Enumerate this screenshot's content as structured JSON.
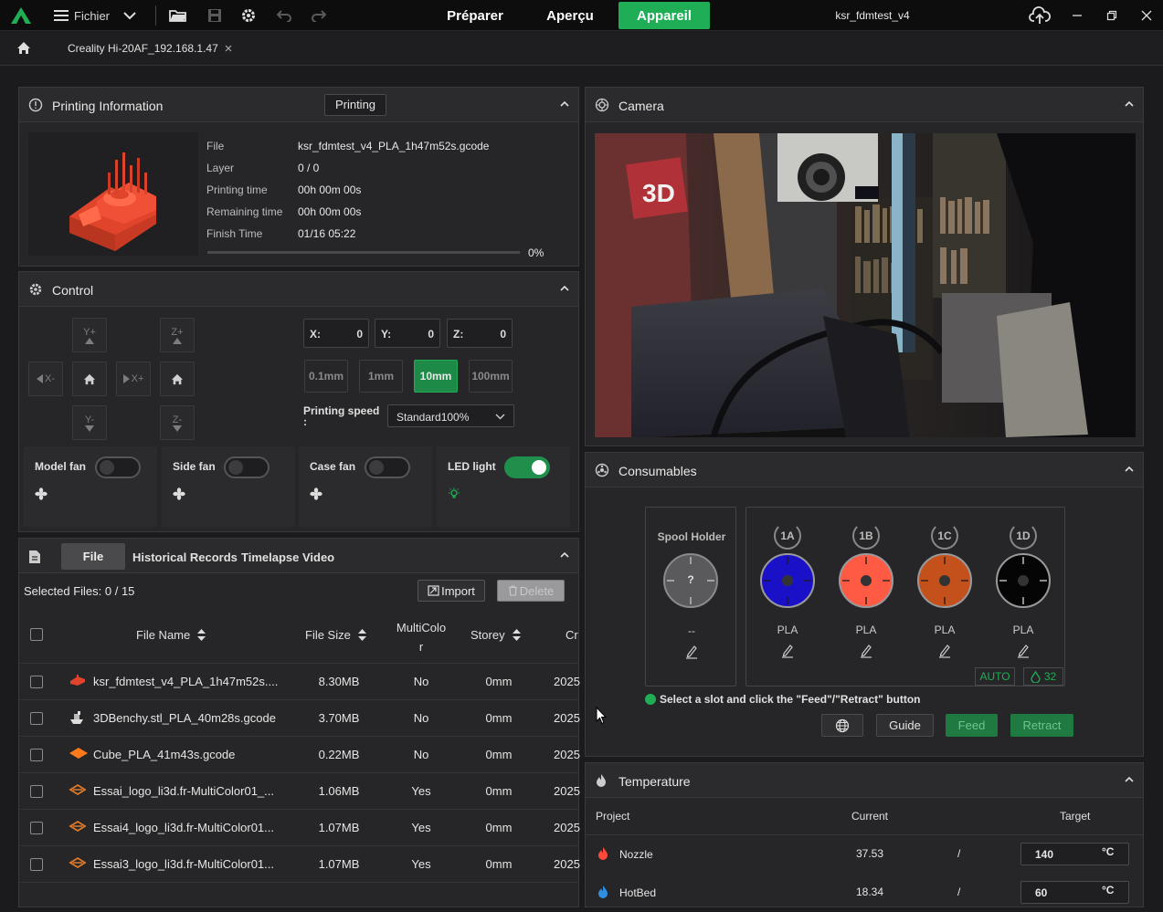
{
  "app": {
    "menu_label": "Fichier",
    "modes": [
      "Préparer",
      "Aperçu",
      "Appareil"
    ],
    "active_mode": "Appareil",
    "project_title": "ksr_fdmtest_v4"
  },
  "tab": {
    "label": "Creality Hi-20AF_192.168.1.47"
  },
  "printing_info": {
    "title": "Printing Information",
    "status": "Printing",
    "fields": [
      {
        "label": "File",
        "value": "ksr_fdmtest_v4_PLA_1h47m52s.gcode"
      },
      {
        "label": "Layer",
        "value": "0 / 0"
      },
      {
        "label": "Printing time",
        "value": "00h 00m 00s"
      },
      {
        "label": "Remaining time",
        "value": "00h 00m 00s"
      },
      {
        "label": "Finish Time",
        "value": "01/16 05:22"
      }
    ],
    "progress_text": "0%",
    "progress": 0
  },
  "control": {
    "title": "Control",
    "jog": {
      "y_plus": "Y+",
      "y_minus": "Y-",
      "x_minus": "X-",
      "x_plus": "X+",
      "z_plus": "Z+",
      "z_minus": "Z-"
    },
    "coords": [
      {
        "label": "X:",
        "value": "0"
      },
      {
        "label": "Y:",
        "value": "0"
      },
      {
        "label": "Z:",
        "value": "0"
      }
    ],
    "steps": [
      "0.1mm",
      "1mm",
      "10mm",
      "100mm"
    ],
    "active_step": "10mm",
    "speed_label": "Printing speed",
    "speed_colon": ":",
    "speed_value": "Standard100%",
    "fans": [
      {
        "label": "Model fan",
        "on": false
      },
      {
        "label": "Side fan",
        "on": false
      },
      {
        "label": "Case fan",
        "on": false
      },
      {
        "label": "LED light",
        "on": true
      }
    ]
  },
  "files": {
    "tabs": [
      "File",
      "Historical Records",
      "Timelapse Video"
    ],
    "active_tab": "File",
    "selected_text": "Selected Files: 0 / 15",
    "import_label": "Import",
    "delete_label": "Delete",
    "columns": {
      "name": "File Name",
      "size": "File Size",
      "multicolor_a": "MultiColo",
      "multicolor_b": "r",
      "storey": "Storey",
      "created": "Cr"
    },
    "rows": [
      {
        "name": "ksr_fdmtest_v4_PLA_1h47m52s....",
        "size": "8.30MB",
        "multicolor": "No",
        "storey": "0mm",
        "created": "2025",
        "icon": "red-model-icon"
      },
      {
        "name": "3DBenchy.stl_PLA_40m28s.gcode",
        "size": "3.70MB",
        "multicolor": "No",
        "storey": "0mm",
        "created": "2025",
        "icon": "benchy-icon"
      },
      {
        "name": "Cube_PLA_41m43s.gcode",
        "size": "0.22MB",
        "multicolor": "No",
        "storey": "0mm",
        "created": "2025",
        "icon": "cube-icon"
      },
      {
        "name": "Essai_logo_li3d.fr-MultiColor01_...",
        "size": "1.06MB",
        "multicolor": "Yes",
        "storey": "0mm",
        "created": "2025",
        "icon": "logo-icon"
      },
      {
        "name": "Essai4_logo_li3d.fr-MultiColor01...",
        "size": "1.07MB",
        "multicolor": "Yes",
        "storey": "0mm",
        "created": "2025",
        "icon": "logo-icon"
      },
      {
        "name": "Essai3_logo_li3d.fr-MultiColor01...",
        "size": "1.07MB",
        "multicolor": "Yes",
        "storey": "0mm",
        "created": "2025",
        "icon": "logo-icon"
      }
    ]
  },
  "camera": {
    "title": "Camera"
  },
  "consumables": {
    "title": "Consumables",
    "spool": {
      "label": "Spool Holder",
      "glyph": "?",
      "material": "--"
    },
    "slots": [
      {
        "id": "1A",
        "material": "PLA",
        "color": "#1a10c8"
      },
      {
        "id": "1B",
        "material": "PLA",
        "color": "#ff5a44"
      },
      {
        "id": "1C",
        "material": "PLA",
        "color": "#c4501c"
      },
      {
        "id": "1D",
        "material": "PLA",
        "color": "#050505"
      }
    ],
    "auto_label": "AUTO",
    "humidity": "32",
    "hint": "Select a slot and click the \"Feed\"/\"Retract\" button",
    "guide_label": "Guide",
    "feed_label": "Feed",
    "retract_label": "Retract"
  },
  "temperature": {
    "title": "Temperature",
    "columns": {
      "project": "Project",
      "current": "Current",
      "target": "Target"
    },
    "rows": [
      {
        "name": "Nozzle",
        "current": "37.53",
        "sep": "/",
        "target": "140",
        "unit": "°C"
      },
      {
        "name": "HotBed",
        "current": "18.34",
        "sep": "/",
        "target": "60",
        "unit": "°C"
      }
    ]
  },
  "colors": {
    "accent": "#1fae55",
    "background": "#1b1b1d",
    "panel": "#262628"
  }
}
